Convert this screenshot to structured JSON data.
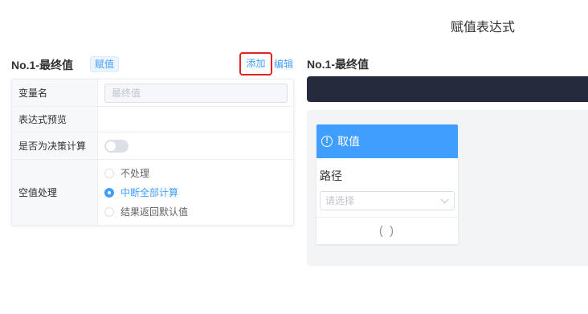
{
  "page": {
    "title": "赋值表达式"
  },
  "left_panel": {
    "item_title": "No.1-最终值",
    "tag": "赋值",
    "add_label": "添加",
    "edit_label": "编辑",
    "rows": {
      "var_name_label": "变量名",
      "var_name_placeholder": "最终值",
      "preview_label": "表达式预览",
      "preview_value": "",
      "decision_label": "是否为决策计算",
      "decision_on": false,
      "null_label": "空值处理",
      "null_options": [
        "不处理",
        "中断全部计算",
        "结果返回默认值"
      ],
      "null_selected": "中断全部计算"
    }
  },
  "right_panel": {
    "item_title": "No.1-最终值",
    "node": {
      "header": "取值",
      "path_label": "路径",
      "select_placeholder": "请选择",
      "footer": "( )"
    }
  },
  "colors": {
    "accent": "#409eff",
    "dark_bar": "#252a3d",
    "highlight": "#e02424"
  },
  "icons": {
    "node_header": "info-circle-icon",
    "select": "chevron-down-icon"
  }
}
